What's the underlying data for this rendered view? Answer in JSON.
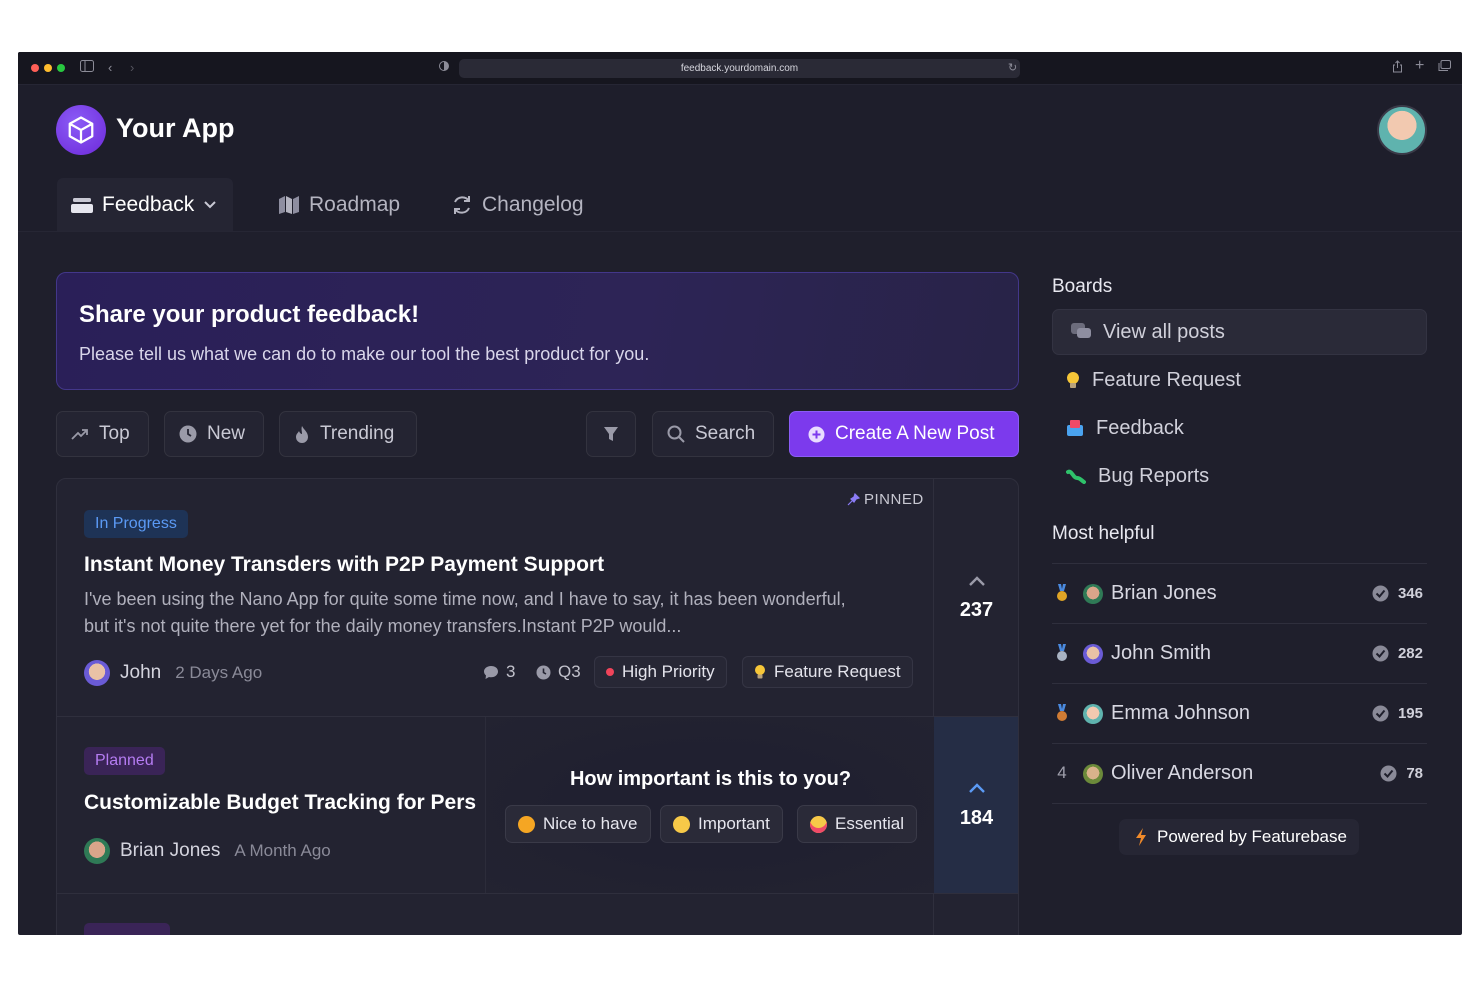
{
  "browser": {
    "url": "feedback.yourdomain.com"
  },
  "app": {
    "name": "Your App"
  },
  "tabs": [
    {
      "label": "Feedback",
      "active": true
    },
    {
      "label": "Roadmap",
      "active": false
    },
    {
      "label": "Changelog",
      "active": false
    }
  ],
  "banner": {
    "title": "Share your product feedback!",
    "subtitle": "Please tell us what we can do to make our tool the best product for you."
  },
  "filters": {
    "top": "Top",
    "new": "New",
    "trending": "Trending",
    "search": "Search",
    "create": "Create A New Post"
  },
  "posts": [
    {
      "status": "In Progress",
      "pinned_label": "PINNED",
      "title": "Instant Money Transders with P2P Payment Support",
      "description": "I've been using the Nano App for quite some time now, and I have to say, it has been wonderful, but it's not quite there yet for the daily money transfers.Instant P2P would...",
      "author": "John",
      "time": "2 Days Ago",
      "comments": "3",
      "eta": "Q3",
      "priority": "High Priority",
      "category": "Feature Request",
      "votes": "237"
    },
    {
      "status": "Planned",
      "title": "Customizable Budget Tracking for Pers",
      "author": "Brian Jones",
      "time": "A Month Ago",
      "votes": "184"
    }
  ],
  "importance": {
    "question": "How important is this to you?",
    "options": [
      "Nice to have",
      "Important",
      "Essential"
    ]
  },
  "sidebar": {
    "boards_title": "Boards",
    "boards": [
      "View all posts",
      "Feature Request",
      "Feedback",
      "Bug Reports"
    ],
    "helpful_title": "Most helpful",
    "helpful": [
      {
        "rank": "",
        "name": "Brian Jones",
        "score": "346",
        "medal": "#e0a526"
      },
      {
        "rank": "",
        "name": "John Smith",
        "score": "282",
        "medal": "#a9b3c3"
      },
      {
        "rank": "",
        "name": "Emma Johnson",
        "score": "195",
        "medal": "#d07c34"
      },
      {
        "rank": "4",
        "name": "Oliver Anderson",
        "score": "78",
        "medal": ""
      }
    ],
    "powered": "Powered by Featurebase"
  },
  "colors": {
    "accent": "#7c3aed",
    "in_progress": "#4d8ff0",
    "planned": "#b57cf2",
    "priority_dot": "#f0445a"
  }
}
